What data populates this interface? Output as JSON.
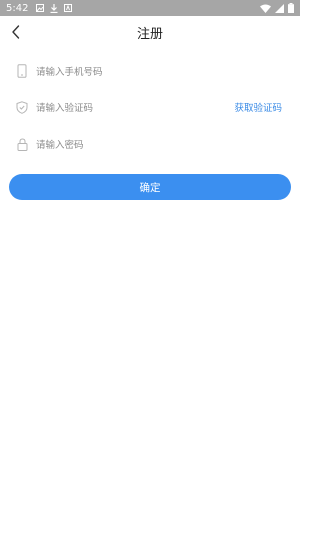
{
  "status_bar": {
    "time": "5:42"
  },
  "header": {
    "title": "注册"
  },
  "form": {
    "phone_placeholder": "请输入手机号码",
    "code_placeholder": "请输入验证码",
    "get_code_label": "获取验证码",
    "password_placeholder": "请输入密码"
  },
  "actions": {
    "confirm_label": "确定"
  },
  "colors": {
    "accent": "#3b8ff0",
    "link": "#3b8be6",
    "status_bar": "#a6a6a6"
  },
  "icons": [
    "phone-icon",
    "shield-icon",
    "lock-icon",
    "back-arrow-icon"
  ]
}
